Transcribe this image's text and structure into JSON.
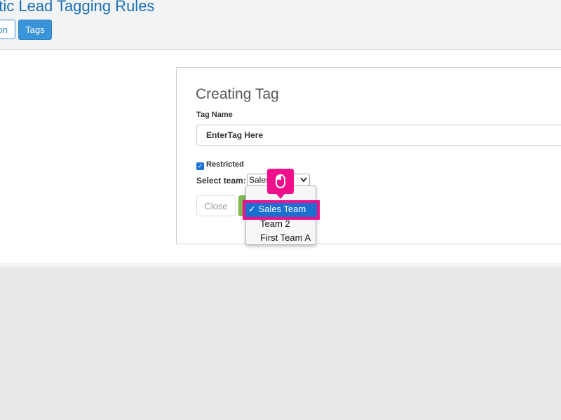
{
  "header": {
    "title": "atic Lead Tagging Rules",
    "nav_partial": "on",
    "nav_tags": "Tags"
  },
  "modal": {
    "title": "Creating Tag",
    "tag_name_label": "Tag Name",
    "tag_name_value": "EnterTag Here",
    "restricted_label": "Restricted",
    "restricted_checked": true,
    "select_team_label": "Select team:",
    "select_team_value": "Sales",
    "close_label": "Close"
  },
  "dropdown": {
    "options": [
      "Sales Team",
      "Team 2",
      "First Team A"
    ],
    "selected_index": 0,
    "check_mark": "✓"
  },
  "colors": {
    "accent": "#3a94d8",
    "highlight": "#f0108c",
    "selected_option": "#1b6fd0",
    "save_button": "#7cb94f"
  },
  "icons": {
    "cursor": "mouse-icon",
    "check": "checkbox-check-icon",
    "chevron": "chevron-down-icon"
  }
}
